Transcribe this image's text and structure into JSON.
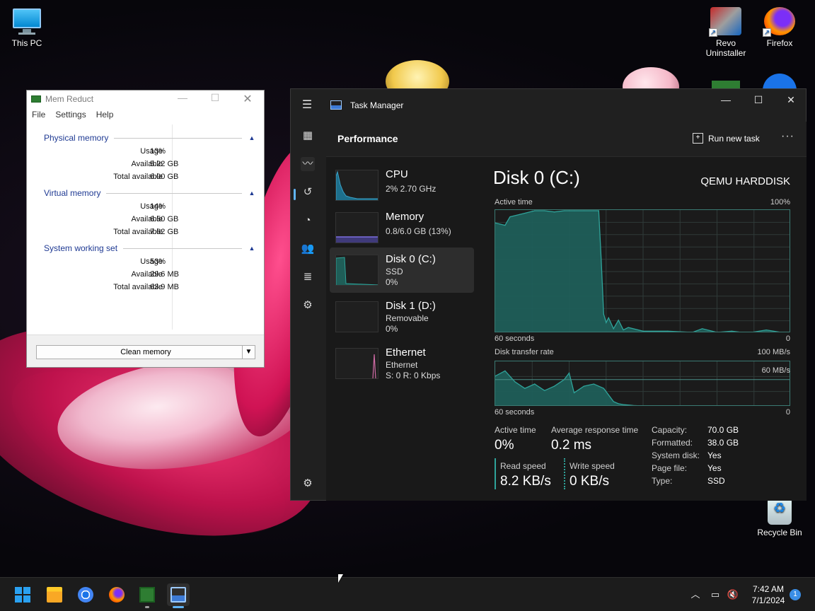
{
  "desktop": {
    "icons": [
      {
        "label": "This PC"
      },
      {
        "label": "Revo Uninstaller"
      },
      {
        "label": "Firefox"
      },
      {
        "label": "Recycle Bin"
      }
    ]
  },
  "memreduct": {
    "title": "Mem Reduct",
    "menu": [
      "File",
      "Settings",
      "Help"
    ],
    "sections": [
      {
        "title": "Physical memory",
        "rows": [
          {
            "label": "Usage",
            "value": "13%"
          },
          {
            "label": "Available",
            "value": "5.22 GB"
          },
          {
            "label": "Total available",
            "value": "6.00 GB"
          }
        ]
      },
      {
        "title": "Virtual memory",
        "rows": [
          {
            "label": "Usage",
            "value": "14%"
          },
          {
            "label": "Available",
            "value": "6.50 GB"
          },
          {
            "label": "Total available",
            "value": "7.62 GB"
          }
        ]
      },
      {
        "title": "System working set",
        "rows": [
          {
            "label": "Usage",
            "value": "53%"
          },
          {
            "label": "Available",
            "value": "29.6 MB"
          },
          {
            "label": "Total available",
            "value": "63.9 MB"
          }
        ]
      }
    ],
    "clean_button": "Clean memory"
  },
  "taskmgr": {
    "title": "Task Manager",
    "page": "Performance",
    "run_new_task": "Run new task",
    "more": "···",
    "items": [
      {
        "name": "CPU",
        "sub1": "2% 2.70 GHz",
        "sub2": ""
      },
      {
        "name": "Memory",
        "sub1": "0.8/6.0 GB (13%)",
        "sub2": ""
      },
      {
        "name": "Disk 0 (C:)",
        "sub1": "SSD",
        "sub2": "0%"
      },
      {
        "name": "Disk 1 (D:)",
        "sub1": "Removable",
        "sub2": "0%"
      },
      {
        "name": "Ethernet",
        "sub1": "Ethernet",
        "sub2": "S: 0 R: 0 Kbps"
      }
    ],
    "detail": {
      "title": "Disk 0 (C:)",
      "model": "QEMU HARDDISK",
      "chart1": {
        "label": "Active time",
        "max": "100%",
        "time": "60 seconds",
        "min": "0"
      },
      "chart2": {
        "label": "Disk transfer rate",
        "max": "100 MB/s",
        "mark": "60 MB/s",
        "time": "60 seconds",
        "min": "0"
      },
      "active_time_label": "Active time",
      "active_time_value": "0%",
      "avg_resp_label": "Average response time",
      "avg_resp_value": "0.2 ms",
      "read_label": "Read speed",
      "read_value": "8.2 KB/s",
      "write_label": "Write speed",
      "write_value": "0 KB/s",
      "props": [
        {
          "k": "Capacity:",
          "v": "70.0 GB"
        },
        {
          "k": "Formatted:",
          "v": "38.0 GB"
        },
        {
          "k": "System disk:",
          "v": "Yes"
        },
        {
          "k": "Page file:",
          "v": "Yes"
        },
        {
          "k": "Type:",
          "v": "SSD"
        }
      ]
    }
  },
  "chart_data": [
    {
      "type": "area",
      "title": "Active time",
      "xlabel": "60 seconds",
      "ylim": [
        0,
        100
      ],
      "x": [
        60,
        58,
        57,
        55,
        52,
        50,
        48,
        46,
        44,
        42,
        40,
        39,
        38.5,
        38,
        37.5,
        37,
        36,
        35,
        34,
        33,
        30,
        25,
        20,
        18,
        15,
        12,
        10,
        8,
        5,
        2,
        0
      ],
      "values": [
        90,
        88,
        95,
        97,
        100,
        100,
        99,
        100,
        100,
        100,
        100,
        100,
        60,
        15,
        8,
        12,
        3,
        10,
        2,
        4,
        1,
        1,
        0,
        3,
        0,
        1,
        0,
        0,
        2,
        0,
        0
      ]
    },
    {
      "type": "area",
      "title": "Disk transfer rate",
      "xlabel": "60 seconds",
      "ylabel": "MB/s",
      "ylim": [
        0,
        100
      ],
      "x": [
        60,
        58,
        56,
        54,
        52,
        50,
        48,
        46,
        45,
        44,
        42,
        40,
        38,
        36,
        35,
        34,
        32,
        30,
        25,
        20,
        15,
        10,
        5,
        0
      ],
      "values": [
        68,
        80,
        55,
        40,
        50,
        35,
        45,
        60,
        75,
        30,
        45,
        50,
        40,
        10,
        5,
        3,
        1,
        0,
        0,
        0,
        0,
        0,
        0,
        0
      ]
    }
  ],
  "taskbar": {
    "time": "7:42 AM",
    "date": "7/1/2024",
    "notifications": "1"
  },
  "colors": {
    "accent": "#60b4f6",
    "disk_line": "#2fa39a",
    "disk_fill": "#1f5e58",
    "cpu_fill": "#1d6f8c",
    "memory_fill": "#5a4fa8",
    "ethernet_line": "#d06ba5",
    "mr_section": "#1f3a93"
  }
}
